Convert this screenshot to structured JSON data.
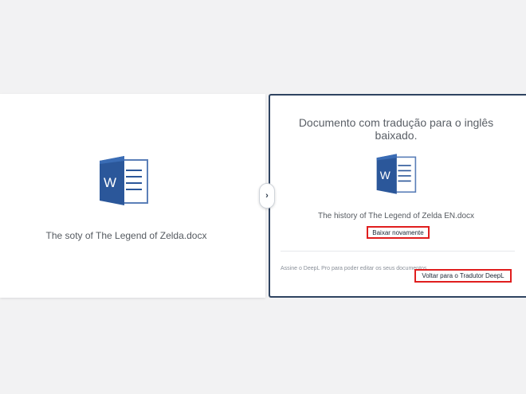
{
  "left_panel": {
    "filename": "The soty of The Legend of Zelda.docx"
  },
  "toggle": {
    "glyph": "›"
  },
  "right_panel": {
    "title": "Documento com tradução para o inglês baixado.",
    "filename": "The history of The Legend of Zelda EN.docx",
    "download_again_label": "Baixar novamente",
    "signup_text": "Assine o DeepL Pro para poder editar os seus documentos.",
    "back_label": "Voltar para o Tradutor DeepL"
  },
  "colors": {
    "word_blue": "#2b579a",
    "word_blue_dark": "#1e4e8c",
    "highlight_red": "#e01e1e",
    "panel_border": "#2f4461",
    "background": "#f2f2f3"
  },
  "icons": {
    "document_icon": "word-document-icon",
    "toggle_icon": "chevron-right-icon"
  }
}
